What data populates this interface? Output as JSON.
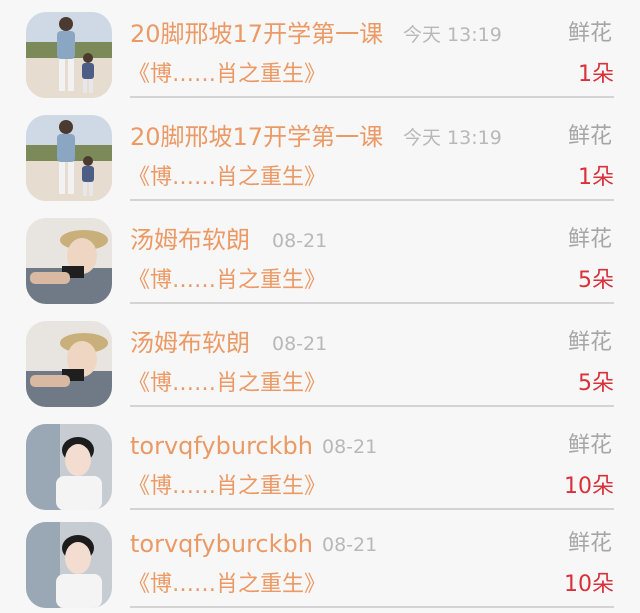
{
  "colors": {
    "name": "#eb9a66",
    "time": "#b8b8b8",
    "gift_label": "#a6a6a6",
    "count": "#d9303a",
    "divider": "#d3d3d3",
    "background": "#f7f7f7"
  },
  "records": [
    {
      "name": "20脚邢坡17开学第一课",
      "time": "今天 13:19",
      "gift": "鲜花",
      "work": "《博……肖之重生》",
      "count": "1朵",
      "avatar": "father-son-photo"
    },
    {
      "name": "20脚邢坡17开学第一课",
      "time": "今天 13:19",
      "gift": "鲜花",
      "work": "《博……肖之重生》",
      "count": "1朵",
      "avatar": "father-son-photo"
    },
    {
      "name": "汤姆布软朗",
      "time": "08-21",
      "gift": "鲜花",
      "work": "《博……肖之重生》",
      "count": "5朵",
      "avatar": "young-man-hat-photo"
    },
    {
      "name": "汤姆布软朗",
      "time": "08-21",
      "gift": "鲜花",
      "work": "《博……肖之重生》",
      "count": "5朵",
      "avatar": "young-man-hat-photo"
    },
    {
      "name": "torvqfyburckbh",
      "time": "08-21",
      "gift": "鲜花",
      "work": "《博……肖之重生》",
      "count": "10朵",
      "avatar": "young-man-white-photo"
    },
    {
      "name": "torvqfyburckbh",
      "time": "08-21",
      "gift": "鲜花",
      "work": "《博……肖之重生》",
      "count": "10朵",
      "avatar": "young-man-white-photo"
    }
  ]
}
